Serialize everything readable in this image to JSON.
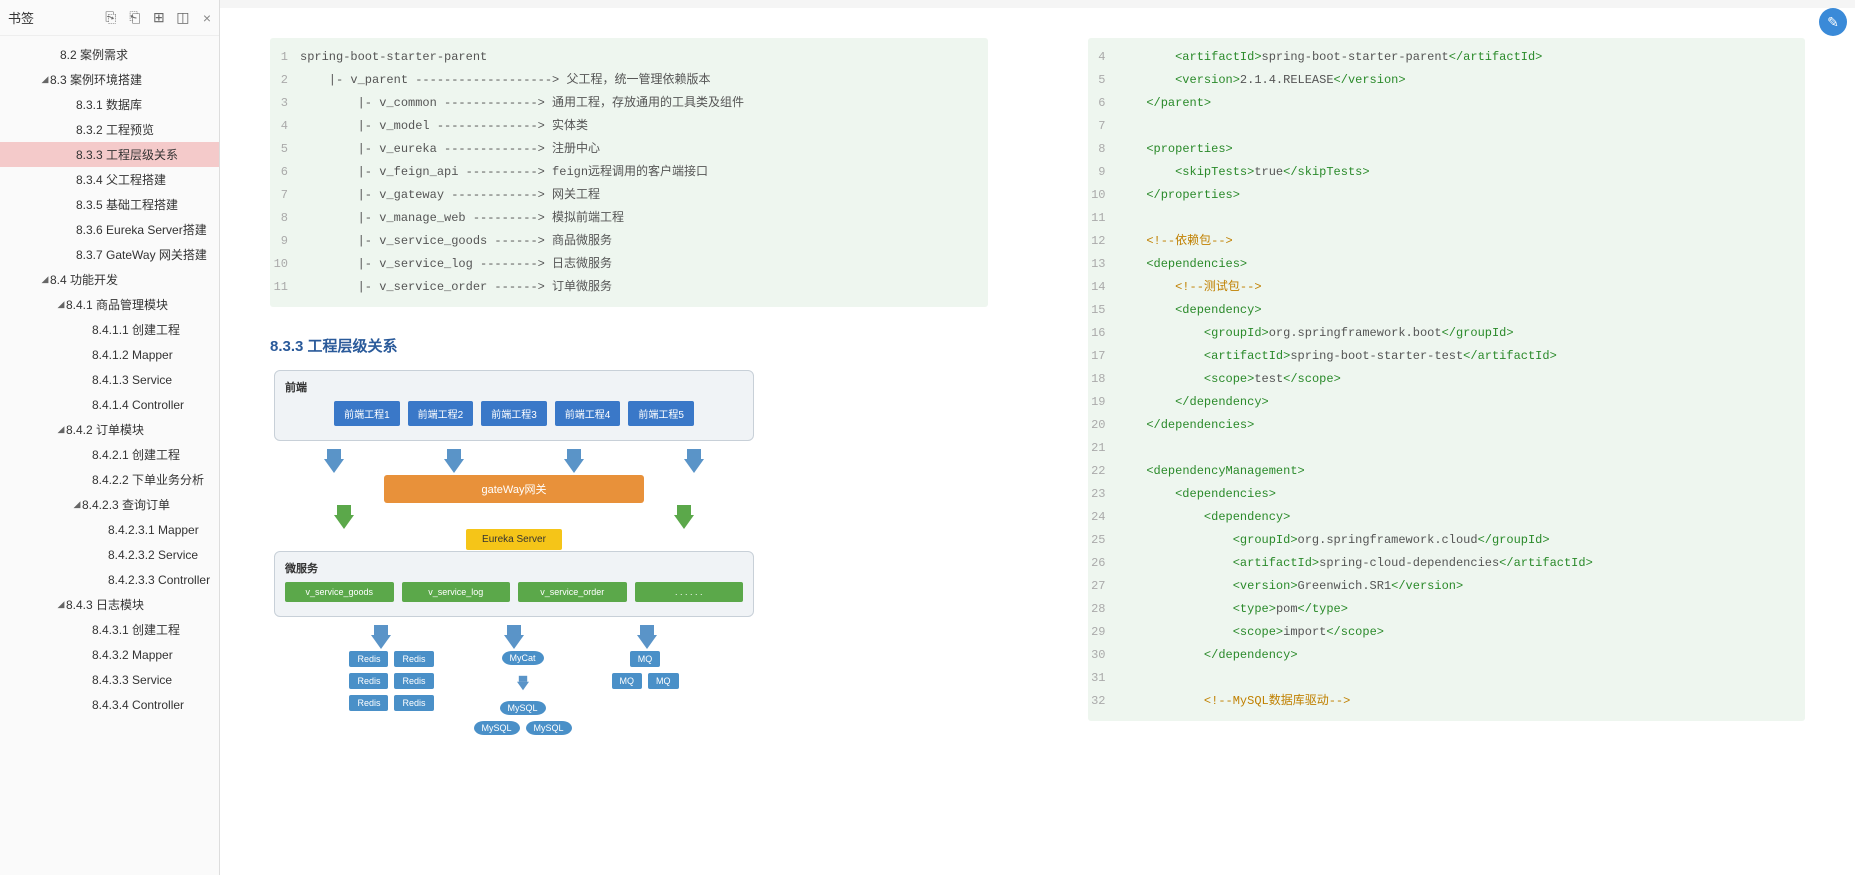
{
  "sidebar": {
    "title": "书签",
    "icons": [
      "bookmark-expand-icon",
      "bookmark-collapse-icon",
      "bookmark-add-icon",
      "bookmark-new-icon"
    ],
    "close": "×",
    "tree": [
      {
        "label": "8.2 案例需求",
        "indent": 50,
        "caret": ""
      },
      {
        "label": "8.3 案例环境搭建",
        "indent": 40,
        "caret": "◢"
      },
      {
        "label": "8.3.1 数据库",
        "indent": 66,
        "caret": ""
      },
      {
        "label": "8.3.2 工程预览",
        "indent": 66,
        "caret": ""
      },
      {
        "label": "8.3.3 工程层级关系",
        "indent": 66,
        "caret": "",
        "active": true
      },
      {
        "label": "8.3.4 父工程搭建",
        "indent": 66,
        "caret": ""
      },
      {
        "label": "8.3.5 基础工程搭建",
        "indent": 66,
        "caret": ""
      },
      {
        "label": "8.3.6 Eureka Server搭建",
        "indent": 66,
        "caret": ""
      },
      {
        "label": "8.3.7 GateWay 网关搭建",
        "indent": 66,
        "caret": ""
      },
      {
        "label": "8.4 功能开发",
        "indent": 40,
        "caret": "◢"
      },
      {
        "label": "8.4.1 商品管理模块",
        "indent": 56,
        "caret": "◢"
      },
      {
        "label": "8.4.1.1 创建工程",
        "indent": 82,
        "caret": ""
      },
      {
        "label": "8.4.1.2 Mapper",
        "indent": 82,
        "caret": ""
      },
      {
        "label": "8.4.1.3 Service",
        "indent": 82,
        "caret": ""
      },
      {
        "label": "8.4.1.4 Controller",
        "indent": 82,
        "caret": ""
      },
      {
        "label": "8.4.2 订单模块",
        "indent": 56,
        "caret": "◢"
      },
      {
        "label": "8.4.2.1 创建工程",
        "indent": 82,
        "caret": ""
      },
      {
        "label": "8.4.2.2 下单业务分析",
        "indent": 82,
        "caret": ""
      },
      {
        "label": "8.4.2.3 查询订单",
        "indent": 72,
        "caret": "◢"
      },
      {
        "label": "8.4.2.3.1 Mapper",
        "indent": 98,
        "caret": ""
      },
      {
        "label": "8.4.2.3.2 Service",
        "indent": 98,
        "caret": ""
      },
      {
        "label": "8.4.2.3.3 Controller",
        "indent": 98,
        "caret": ""
      },
      {
        "label": "8.4.3 日志模块",
        "indent": 56,
        "caret": "◢"
      },
      {
        "label": "8.4.3.1 创建工程",
        "indent": 82,
        "caret": ""
      },
      {
        "label": "8.4.3.2 Mapper",
        "indent": 82,
        "caret": ""
      },
      {
        "label": "8.4.3.3 Service",
        "indent": 82,
        "caret": ""
      },
      {
        "label": "8.4.3.4 Controller",
        "indent": 82,
        "caret": ""
      }
    ]
  },
  "left_code": {
    "lines": [
      {
        "n": "1",
        "t": "spring-boot-starter-parent"
      },
      {
        "n": "2",
        "t": "    |- v_parent -------------------> 父工程，统一管理依赖版本"
      },
      {
        "n": "3",
        "t": "        |- v_common -------------> 通用工程，存放通用的工具类及组件"
      },
      {
        "n": "4",
        "t": "        |- v_model --------------> 实体类"
      },
      {
        "n": "5",
        "t": "        |- v_eureka -------------> 注册中心"
      },
      {
        "n": "6",
        "t": "        |- v_feign_api ----------> feign远程调用的客户端接口"
      },
      {
        "n": "7",
        "t": "        |- v_gateway ------------> 网关工程"
      },
      {
        "n": "8",
        "t": "        |- v_manage_web ---------> 模拟前端工程"
      },
      {
        "n": "9",
        "t": "        |- v_service_goods ------> 商品微服务"
      },
      {
        "n": "10",
        "t": "        |- v_service_log --------> 日志微服务"
      },
      {
        "n": "11",
        "t": "        |- v_service_order ------> 订单微服务"
      }
    ]
  },
  "section_heading": "8.3.3 工程层级关系",
  "diagram": {
    "frame1_label": "前端",
    "frontends": [
      "前端工程1",
      "前端工程2",
      "前端工程3",
      "前端工程4",
      "前端工程5"
    ],
    "gateway": "gateWay网关",
    "eureka": "Eureka Server",
    "frame2_label": "微服务",
    "services": [
      "v_service_goods",
      "v_service_log",
      "v_service_order",
      ". . . . . ."
    ],
    "redis": "Redis",
    "mycat": "MyCat",
    "mysql": "MySQL",
    "mq": "MQ"
  },
  "right_code": {
    "lines": [
      {
        "n": "4",
        "html": "        <span class='tag'>&lt;artifactId&gt;</span>spring-boot-starter-parent<span class='tag'>&lt;/artifactId&gt;</span>"
      },
      {
        "n": "5",
        "html": "        <span class='tag'>&lt;version&gt;</span>2.1.4.RELEASE<span class='tag'>&lt;/version&gt;</span>"
      },
      {
        "n": "6",
        "html": "    <span class='tag'>&lt;/parent&gt;</span>"
      },
      {
        "n": "7",
        "html": ""
      },
      {
        "n": "8",
        "html": "    <span class='tag'>&lt;properties&gt;</span>"
      },
      {
        "n": "9",
        "html": "        <span class='tag'>&lt;skipTests&gt;</span>true<span class='tag'>&lt;/skipTests&gt;</span>"
      },
      {
        "n": "10",
        "html": "    <span class='tag'>&lt;/properties&gt;</span>"
      },
      {
        "n": "11",
        "html": ""
      },
      {
        "n": "12",
        "html": "    <span class='comment'>&lt;!--依赖包--&gt;</span>"
      },
      {
        "n": "13",
        "html": "    <span class='tag'>&lt;dependencies&gt;</span>"
      },
      {
        "n": "14",
        "html": "        <span class='comment'>&lt;!--测试包--&gt;</span>"
      },
      {
        "n": "15",
        "html": "        <span class='tag'>&lt;dependency&gt;</span>"
      },
      {
        "n": "16",
        "html": "            <span class='tag'>&lt;groupId&gt;</span>org.springframework.boot<span class='tag'>&lt;/groupId&gt;</span>"
      },
      {
        "n": "17",
        "html": "            <span class='tag'>&lt;artifactId&gt;</span>spring-boot-starter-test<span class='tag'>&lt;/artifactId&gt;</span>"
      },
      {
        "n": "18",
        "html": "            <span class='tag'>&lt;scope&gt;</span>test<span class='tag'>&lt;/scope&gt;</span>"
      },
      {
        "n": "19",
        "html": "        <span class='tag'>&lt;/dependency&gt;</span>"
      },
      {
        "n": "20",
        "html": "    <span class='tag'>&lt;/dependencies&gt;</span>"
      },
      {
        "n": "21",
        "html": ""
      },
      {
        "n": "22",
        "html": "    <span class='tag'>&lt;dependencyManagement&gt;</span>"
      },
      {
        "n": "23",
        "html": "        <span class='tag'>&lt;dependencies&gt;</span>"
      },
      {
        "n": "24",
        "html": "            <span class='tag'>&lt;dependency&gt;</span>"
      },
      {
        "n": "25",
        "html": "                <span class='tag'>&lt;groupId&gt;</span>org.springframework.cloud<span class='tag'>&lt;/groupId&gt;</span>"
      },
      {
        "n": "26",
        "html": "                <span class='tag'>&lt;artifactId&gt;</span>spring-cloud-dependencies<span class='tag'>&lt;/artifactId&gt;</span>"
      },
      {
        "n": "27",
        "html": "                <span class='tag'>&lt;version&gt;</span>Greenwich.SR1<span class='tag'>&lt;/version&gt;</span>"
      },
      {
        "n": "28",
        "html": "                <span class='tag'>&lt;type&gt;</span>pom<span class='tag'>&lt;/type&gt;</span>"
      },
      {
        "n": "29",
        "html": "                <span class='tag'>&lt;scope&gt;</span>import<span class='tag'>&lt;/scope&gt;</span>"
      },
      {
        "n": "30",
        "html": "            <span class='tag'>&lt;/dependency&gt;</span>"
      },
      {
        "n": "31",
        "html": ""
      },
      {
        "n": "32",
        "html": "            <span class='comment'>&lt;!--MySQL数据库驱动--&gt;</span>"
      }
    ]
  }
}
